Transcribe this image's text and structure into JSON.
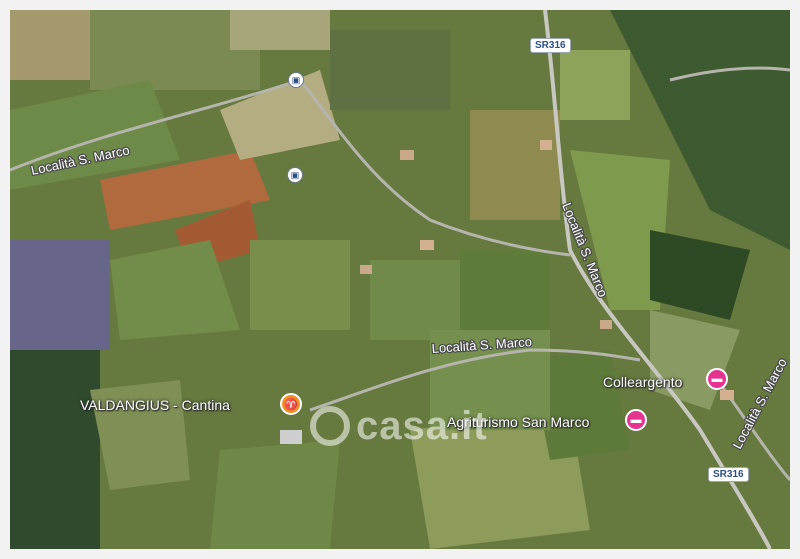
{
  "roads": {
    "road_1": "Località S. Marco",
    "road_2": "Località S. Marco",
    "road_3": "Località S. Marco",
    "road_4": "Località S. Marco"
  },
  "shields": {
    "top": "SR316",
    "bottom": "SR316"
  },
  "pois": [
    {
      "label": "Colleargento",
      "icon": "bed-icon",
      "color": "#e5338f"
    },
    {
      "label": "Agriturismo San Marco",
      "icon": "bed-icon",
      "color": "#e5338f"
    },
    {
      "label": "VALDANGIUS - Cantina",
      "icon": "wine-glass-icon",
      "color": "#f28c28"
    }
  ],
  "watermark": "casa.it",
  "transit": [
    "bus-stop-icon",
    "bus-stop-icon"
  ]
}
